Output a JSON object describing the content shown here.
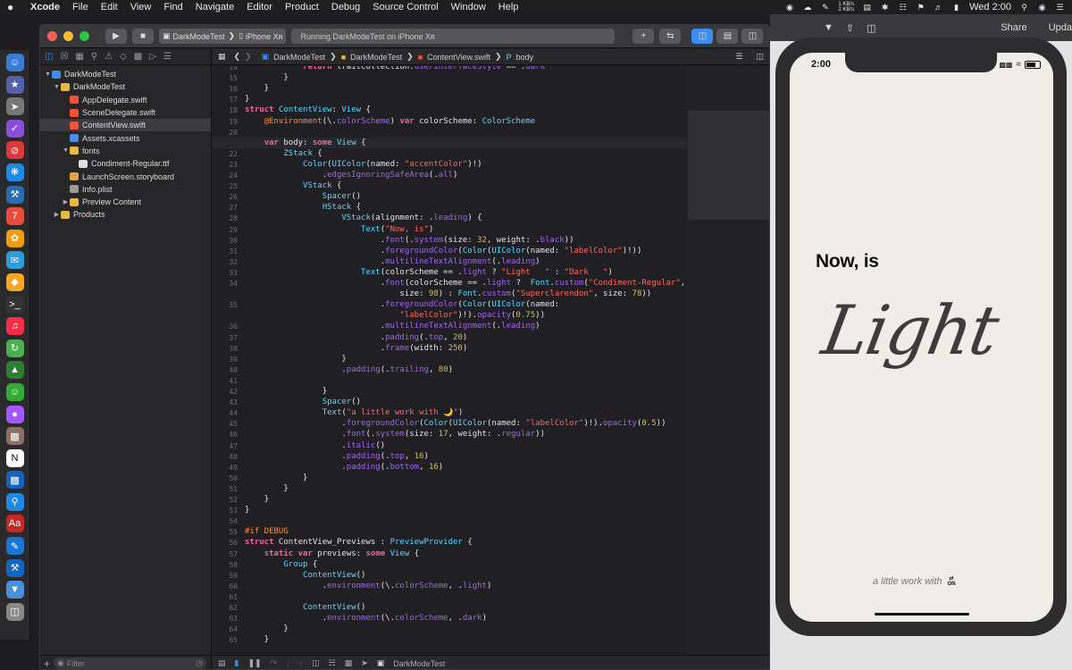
{
  "menubar": {
    "app_name": "Xcode",
    "menus": [
      "File",
      "Edit",
      "View",
      "Find",
      "Navigate",
      "Editor",
      "Product",
      "Debug",
      "Source Control",
      "Window",
      "Help"
    ],
    "net_up": "1 KB/s",
    "net_down": "2 KB/s",
    "clock": "Wed 2:00"
  },
  "toolbar": {
    "scheme": "DarkModeTest",
    "device": "iPhone Xʀ",
    "activity": "Running DarkModeTest on iPhone Xʀ",
    "canvas_share": "Share",
    "canvas_update": "Upda"
  },
  "navigator": {
    "filter_placeholder": "Filter",
    "tree": [
      {
        "label": "DarkModeTest",
        "icon": "project-icon",
        "indent": 0,
        "disclosure": "▼",
        "type": "proj"
      },
      {
        "label": "DarkModeTest",
        "icon": "folder-icon",
        "indent": 1,
        "disclosure": "▼",
        "type": "folder"
      },
      {
        "label": "AppDelegate.swift",
        "icon": "swift-file-icon",
        "indent": 2,
        "disclosure": "",
        "type": "swift"
      },
      {
        "label": "SceneDelegate.swift",
        "icon": "swift-file-icon",
        "indent": 2,
        "disclosure": "",
        "type": "swift"
      },
      {
        "label": "ContentView.swift",
        "icon": "swift-file-icon",
        "indent": 2,
        "disclosure": "",
        "type": "swift",
        "selected": true
      },
      {
        "label": "Assets.xcassets",
        "icon": "assets-icon",
        "indent": 2,
        "disclosure": "",
        "type": "assets"
      },
      {
        "label": "fonts",
        "icon": "folder-icon",
        "indent": 2,
        "disclosure": "▼",
        "type": "folder"
      },
      {
        "label": "Condiment-Regular.ttf",
        "icon": "font-file-icon",
        "indent": 3,
        "disclosure": "",
        "type": "ttf"
      },
      {
        "label": "LaunchScreen.storyboard",
        "icon": "storyboard-icon",
        "indent": 2,
        "disclosure": "",
        "type": "storyboard"
      },
      {
        "label": "Info.plist",
        "icon": "plist-icon",
        "indent": 2,
        "disclosure": "",
        "type": "plist"
      },
      {
        "label": "Preview Content",
        "icon": "folder-icon",
        "indent": 2,
        "disclosure": "▶",
        "type": "folder"
      },
      {
        "label": "Products",
        "icon": "folder-icon",
        "indent": 1,
        "disclosure": "▶",
        "type": "folder"
      }
    ]
  },
  "jumpbar": {
    "crumbs": [
      "DarkModeTest",
      "DarkModeTest",
      "ContentView.swift",
      "body"
    ]
  },
  "editor": {
    "current_line": 21,
    "lines": [
      {
        "n": "14",
        "t": "            return traitCollection.userInterfaceStyle == .dark"
      },
      {
        "n": "15",
        "t": "        }"
      },
      {
        "n": "16",
        "t": "    }"
      },
      {
        "n": "17",
        "t": "}"
      },
      {
        "n": "18",
        "t": "struct ContentView: View {"
      },
      {
        "n": "19",
        "t": "    @Environment(\\.colorScheme) var colorScheme: ColorScheme"
      },
      {
        "n": "20",
        "t": ""
      },
      {
        "n": "21",
        "t": "    var body: some View {"
      },
      {
        "n": "22",
        "t": "        ZStack {"
      },
      {
        "n": "23",
        "t": "            Color(UIColor(named: \"accentColor\")!)"
      },
      {
        "n": "24",
        "t": "                .edgesIgnoringSafeArea(.all)"
      },
      {
        "n": "25",
        "t": "            VStack {"
      },
      {
        "n": "26",
        "t": "                Spacer()"
      },
      {
        "n": "27",
        "t": "                HStack {"
      },
      {
        "n": "28",
        "t": "                    VStack(alignment: .leading) {"
      },
      {
        "n": "29",
        "t": "                        Text(\"Now, is\")"
      },
      {
        "n": "30",
        "t": "                            .font(.system(size: 32, weight: .black))"
      },
      {
        "n": "31",
        "t": "                            .foregroundColor(Color(UIColor(named: \"labelColor\")!))"
      },
      {
        "n": "32",
        "t": "                            .multilineTextAlignment(.leading)"
      },
      {
        "n": "33",
        "t": "                        Text(colorScheme == .light ? \"Light   \" : \"Dark   \")"
      },
      {
        "n": "34",
        "t": "                            .font(colorScheme == .light ?  Font.custom(\"Condiment-Regular\","
      },
      {
        "n": "",
        "t": "                                size: 98) : Font.custom(\"Superclarendon\", size: 78))"
      },
      {
        "n": "35",
        "t": "                            .foregroundColor(Color(UIColor(named:"
      },
      {
        "n": "",
        "t": "                                \"labelColor\")!).opacity(0.75))"
      },
      {
        "n": "36",
        "t": "                            .multilineTextAlignment(.leading)"
      },
      {
        "n": "37",
        "t": "                            .padding(.top, 20)"
      },
      {
        "n": "38",
        "t": "                            .frame(width: 250)"
      },
      {
        "n": "39",
        "t": "                    }"
      },
      {
        "n": "40",
        "t": "                    .padding(.trailing, 80)"
      },
      {
        "n": "41",
        "t": ""
      },
      {
        "n": "42",
        "t": "                }"
      },
      {
        "n": "43",
        "t": "                Spacer()"
      },
      {
        "n": "44",
        "t": "                Text(\"a little work with 🌙\")"
      },
      {
        "n": "45",
        "t": "                    .foregroundColor(Color(UIColor(named: \"labelColor\")!).opacity(0.5))"
      },
      {
        "n": "46",
        "t": "                    .font(.system(size: 17, weight: .regular))"
      },
      {
        "n": "47",
        "t": "                    .italic()"
      },
      {
        "n": "48",
        "t": "                    .padding(.top, 16)"
      },
      {
        "n": "49",
        "t": "                    .padding(.bottom, 16)"
      },
      {
        "n": "50",
        "t": "            }"
      },
      {
        "n": "51",
        "t": "        }"
      },
      {
        "n": "52",
        "t": "    }"
      },
      {
        "n": "53",
        "t": "}"
      },
      {
        "n": "54",
        "t": ""
      },
      {
        "n": "55",
        "t": "#if DEBUG"
      },
      {
        "n": "56",
        "t": "struct ContentView_Previews : PreviewProvider {"
      },
      {
        "n": "57",
        "t": "    static var previews: some View {"
      },
      {
        "n": "58",
        "t": "        Group {"
      },
      {
        "n": "59",
        "t": "            ContentView()"
      },
      {
        "n": "60",
        "t": "                .environment(\\.colorScheme, .light)"
      },
      {
        "n": "61",
        "t": ""
      },
      {
        "n": "62",
        "t": "            ContentView()"
      },
      {
        "n": "63",
        "t": "                .environment(\\.colorScheme, .dark)"
      },
      {
        "n": "64",
        "t": "        }"
      },
      {
        "n": "65",
        "t": "    }"
      }
    ]
  },
  "debugbar": {
    "target": "DarkModeTest"
  },
  "simulator": {
    "time": "2:00",
    "headline": "Now, is",
    "display_word": "Light",
    "footer": "a little work with",
    "footer_badge": "ON"
  },
  "colors": {
    "keyword": "#fc5fa3",
    "type": "#5dd8ff",
    "string": "#fc6a5d",
    "number": "#d0bf69",
    "accent": "#3b8ef0"
  }
}
